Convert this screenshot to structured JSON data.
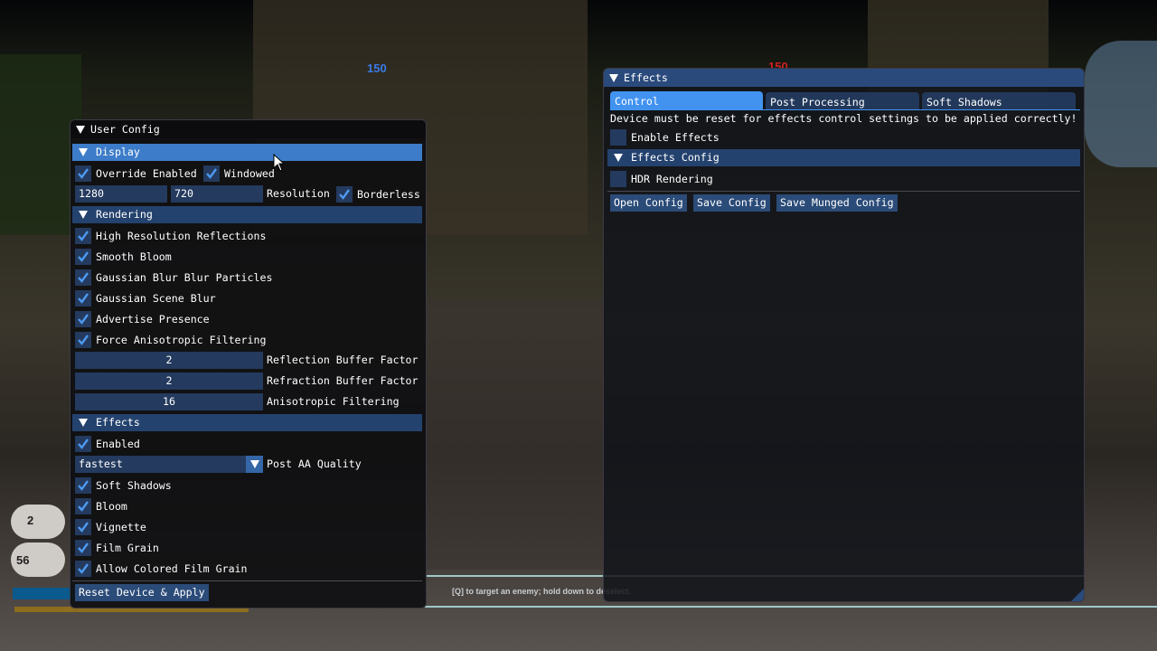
{
  "hud": {
    "score_blue": "150",
    "score_red": "150",
    "counter_top": "2",
    "counter_bottom": "56",
    "hint": "[Q] to target an enemy; hold down to deselect."
  },
  "colors": {
    "header": "#24426e",
    "header_active": "#3d7cc9",
    "frame": "#243a5e",
    "check": "#4d9af0",
    "tab_active": "#4293f0",
    "button": "#2b4b78"
  },
  "user_config": {
    "title": "User Config",
    "display": {
      "header": "Display",
      "override_enabled": {
        "label": "Override Enabled",
        "checked": true
      },
      "windowed": {
        "label": "Windowed",
        "checked": true
      },
      "width": "1280",
      "height": "720",
      "resolution_label": "Resolution",
      "borderless": {
        "label": "Borderless",
        "checked": true
      }
    },
    "rendering": {
      "header": "Rendering",
      "options": [
        {
          "label": "High Resolution Reflections",
          "checked": true
        },
        {
          "label": "Smooth Bloom",
          "checked": true
        },
        {
          "label": "Gaussian Blur Blur Particles",
          "checked": true
        },
        {
          "label": "Gaussian Scene Blur",
          "checked": true
        },
        {
          "label": "Advertise Presence",
          "checked": true
        },
        {
          "label": "Force Anisotropic Filtering",
          "checked": true
        }
      ],
      "reflection_buffer_factor": {
        "value": "2",
        "label": "Reflection Buffer Factor"
      },
      "refraction_buffer_factor": {
        "value": "2",
        "label": "Refraction Buffer Factor"
      },
      "anisotropic_filtering": {
        "value": "16",
        "label": "Anisotropic Filtering"
      }
    },
    "effects": {
      "header": "Effects",
      "enabled": {
        "label": "Enabled",
        "checked": true
      },
      "post_aa_quality": {
        "value": "fastest",
        "label": "Post AA Quality"
      },
      "options": [
        {
          "label": "Soft Shadows",
          "checked": true
        },
        {
          "label": "Bloom",
          "checked": true
        },
        {
          "label": "Vignette",
          "checked": true
        },
        {
          "label": "Film Grain",
          "checked": true
        },
        {
          "label": "Allow Colored Film Grain",
          "checked": true
        }
      ]
    },
    "reset_button": "Reset Device & Apply"
  },
  "effects_window": {
    "title": "Effects",
    "tabs": [
      {
        "label": "Control",
        "active": true
      },
      {
        "label": "Post Processing",
        "active": false
      },
      {
        "label": "Soft Shadows",
        "active": false
      }
    ],
    "notice": "Device must be reset for effects control settings to be applied correctly!",
    "enable_effects": {
      "label": "Enable Effects",
      "checked": false
    },
    "effects_config_header": "Effects Config",
    "hdr_rendering": {
      "label": "HDR Rendering",
      "checked": false
    },
    "buttons": {
      "open": "Open Config",
      "save": "Save Config",
      "save_munged": "Save Munged Config"
    }
  }
}
